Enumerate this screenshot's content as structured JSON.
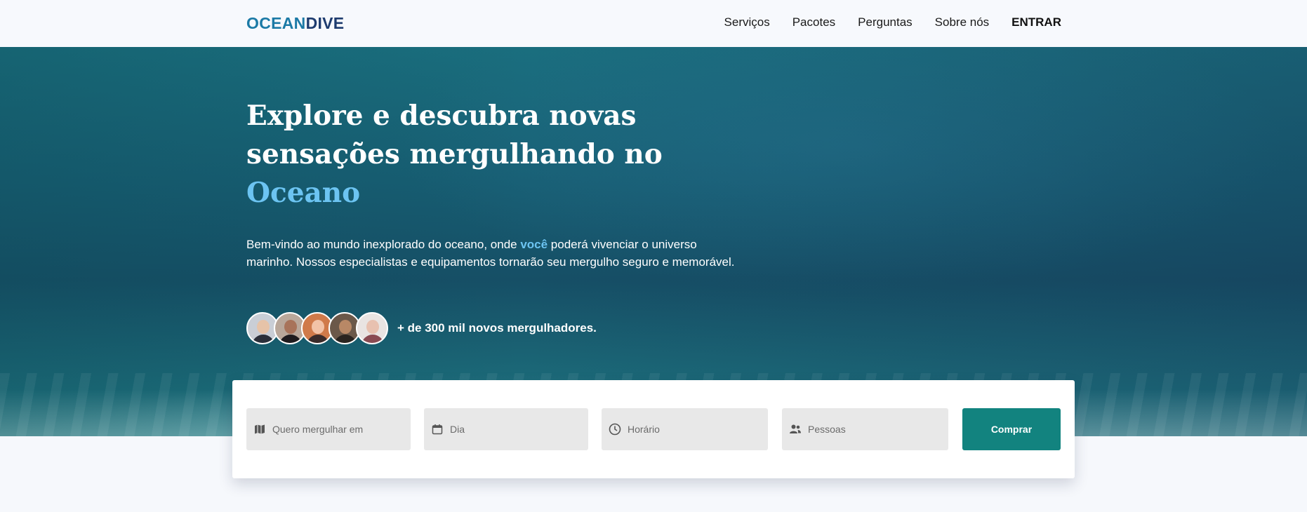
{
  "brand": {
    "part1": "OCEAN",
    "part2": "DIVE"
  },
  "nav": {
    "items": [
      {
        "label": "Serviços"
      },
      {
        "label": "Pacotes"
      },
      {
        "label": "Perguntas"
      },
      {
        "label": "Sobre nós"
      }
    ],
    "login": "ENTRAR"
  },
  "hero": {
    "headline_line1": "Explore e descubra novas",
    "headline_line2": "sensações mergulhando no",
    "headline_accent": "Oceano",
    "intro_before": "Bem-vindo ao mundo inexplorado do oceano, onde ",
    "intro_highlight": "você",
    "intro_after": " poderá vivenciar o universo marinho. Nossos especialistas e equipamentos tornarão seu mergulho seguro e memorável.",
    "divers_text": "+ de 300 mil novos mergulhadores."
  },
  "booking": {
    "destination_placeholder": "Quero mergulhar em",
    "day_placeholder": "Dia",
    "time_placeholder": "Horário",
    "people_placeholder": "Pessoas",
    "buy_label": "Comprar"
  },
  "colors": {
    "accent_light_blue": "#6cc4f2",
    "logo_ocean": "#1c7aa6",
    "logo_dive": "#1e3c6f",
    "buy_button": "#12837f"
  }
}
